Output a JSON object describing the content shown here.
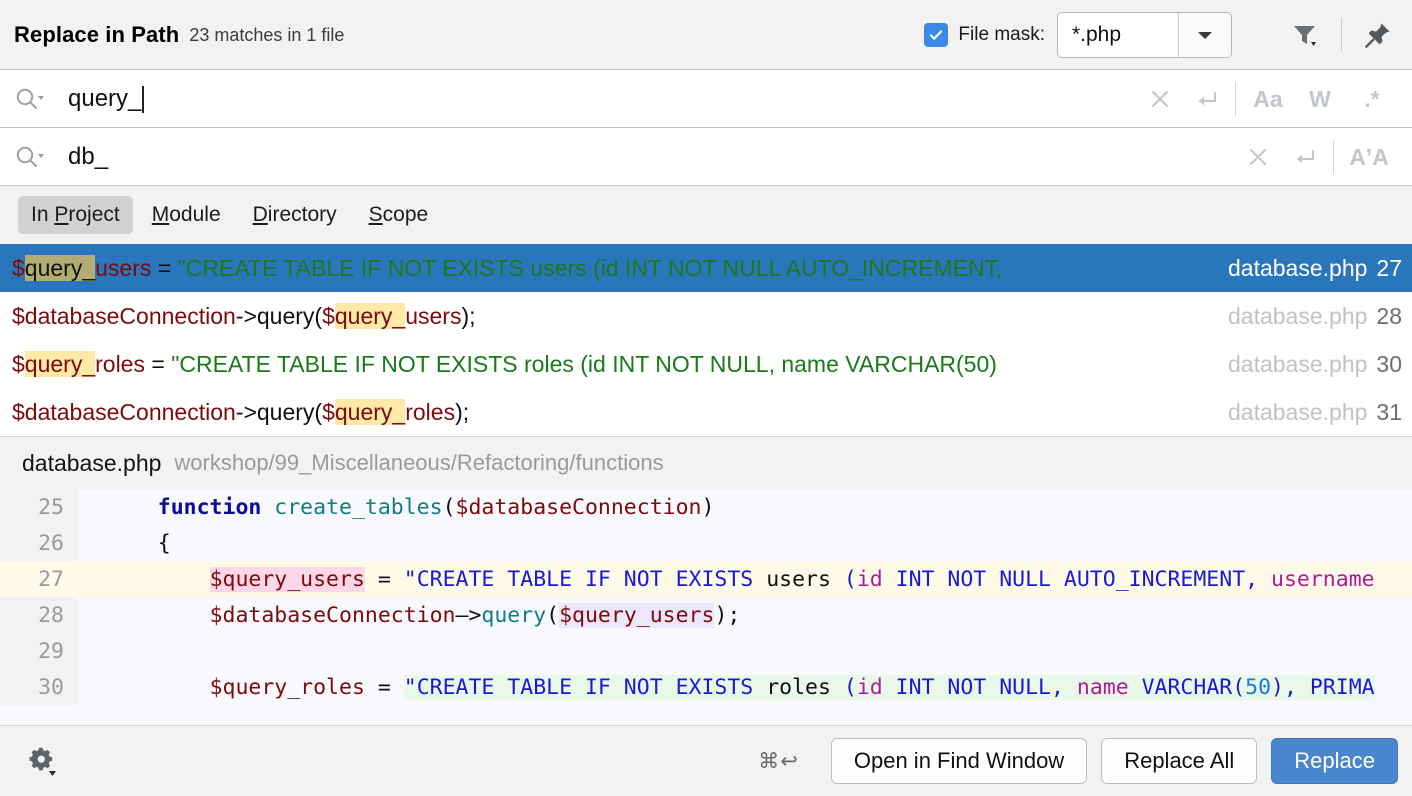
{
  "header": {
    "title": "Replace in Path",
    "subtitle": "23 matches in 1 file",
    "file_mask_label": "File mask:",
    "file_mask_value": "*.php",
    "file_mask_checked": true,
    "filter_icon": "filter-icon",
    "pin_icon": "pin-icon",
    "accent_color": "#4a86cd"
  },
  "search": {
    "value": "query_",
    "icon": "search-icon",
    "clear_icon": "close-icon",
    "history_icon": "new-line-icon",
    "options": [
      {
        "name": "match-case",
        "label": "Aa"
      },
      {
        "name": "words",
        "label": "W"
      },
      {
        "name": "regex",
        "label": ".*"
      }
    ]
  },
  "replace": {
    "value": "db_",
    "icon": "search-icon",
    "clear_icon": "close-icon",
    "history_icon": "new-line-icon",
    "options": [
      {
        "name": "preserve-case",
        "label": "AʼA"
      }
    ]
  },
  "scopes": {
    "items": [
      {
        "name": "in-project",
        "pre": "In ",
        "mnemonic": "P",
        "post": "roject",
        "active": true
      },
      {
        "name": "module",
        "pre": "",
        "mnemonic": "M",
        "post": "odule",
        "active": false
      },
      {
        "name": "directory",
        "pre": "",
        "mnemonic": "D",
        "post": "irectory",
        "active": false
      },
      {
        "name": "scope",
        "pre": "",
        "mnemonic": "S",
        "post": "cope",
        "active": false
      }
    ]
  },
  "results": {
    "rows": [
      {
        "selected": true,
        "file": "database.php",
        "line": "27",
        "segments": [
          {
            "cls": "v",
            "text": "$"
          },
          {
            "cls": "v hl",
            "text": "query_"
          },
          {
            "cls": "v",
            "text": "users"
          },
          {
            "cls": "p",
            "text": " = "
          },
          {
            "cls": "s",
            "text": "\"CREATE TABLE IF NOT EXISTS users (id INT NOT NULL AUTO_INCREMENT,"
          }
        ]
      },
      {
        "selected": false,
        "file": "database.php",
        "line": "28",
        "segments": [
          {
            "cls": "v",
            "text": "$databaseConnection"
          },
          {
            "cls": "p",
            "text": "->query("
          },
          {
            "cls": "v",
            "text": "$"
          },
          {
            "cls": "v hl",
            "text": "query_"
          },
          {
            "cls": "v",
            "text": "users"
          },
          {
            "cls": "p",
            "text": ");"
          }
        ]
      },
      {
        "selected": false,
        "file": "database.php",
        "line": "30",
        "segments": [
          {
            "cls": "v",
            "text": "$"
          },
          {
            "cls": "v hl",
            "text": "query_"
          },
          {
            "cls": "v",
            "text": "roles"
          },
          {
            "cls": "p",
            "text": " = "
          },
          {
            "cls": "s",
            "text": "\"CREATE TABLE IF NOT EXISTS roles (id INT NOT NULL, name VARCHAR(50)"
          }
        ]
      },
      {
        "selected": false,
        "file": "database.php",
        "line": "31",
        "segments": [
          {
            "cls": "v",
            "text": "$databaseConnection"
          },
          {
            "cls": "p",
            "text": "->query("
          },
          {
            "cls": "v",
            "text": "$"
          },
          {
            "cls": "v hl",
            "text": "query_"
          },
          {
            "cls": "v",
            "text": "roles"
          },
          {
            "cls": "p",
            "text": ");"
          }
        ]
      }
    ]
  },
  "preview": {
    "file": "database.php",
    "path": "workshop/99_Miscellaneous/Refactoring/functions",
    "lines": [
      {
        "num": "25",
        "highlight": false,
        "segments": [
          {
            "cls": "op",
            "text": "    "
          },
          {
            "cls": "kw",
            "text": "function"
          },
          {
            "cls": "op",
            "text": " "
          },
          {
            "cls": "fn2",
            "text": "create_tables"
          },
          {
            "cls": "op",
            "text": "("
          },
          {
            "cls": "var",
            "text": "$databaseConnection"
          },
          {
            "cls": "op",
            "text": ")"
          }
        ]
      },
      {
        "num": "26",
        "highlight": false,
        "segments": [
          {
            "cls": "op",
            "text": "    {"
          }
        ]
      },
      {
        "num": "27",
        "highlight": true,
        "segments": [
          {
            "cls": "op",
            "text": "        "
          },
          {
            "cls": "var mpink",
            "text": "$query_users"
          },
          {
            "cls": "op",
            "text": " = "
          },
          {
            "cls": "sqlkw",
            "text": "\"CREATE TABLE IF NOT EXISTS "
          },
          {
            "cls": "sqlplain",
            "text": "users "
          },
          {
            "cls": "sqlkw",
            "text": "("
          },
          {
            "cls": "sqlid",
            "text": "id"
          },
          {
            "cls": "sqlkw",
            "text": " INT NOT NULL AUTO_INCREMENT, "
          },
          {
            "cls": "sqlid",
            "text": "username"
          }
        ]
      },
      {
        "num": "28",
        "highlight": false,
        "segments": [
          {
            "cls": "op",
            "text": "        "
          },
          {
            "cls": "var",
            "text": "$databaseConnection"
          },
          {
            "cls": "op",
            "text": "–>"
          },
          {
            "cls": "fn2",
            "text": "query"
          },
          {
            "cls": "op",
            "text": "("
          },
          {
            "cls": "var mlav",
            "text": "$query_users"
          },
          {
            "cls": "op",
            "text": ");"
          }
        ]
      },
      {
        "num": "29",
        "highlight": false,
        "segments": [
          {
            "cls": "op",
            "text": ""
          }
        ]
      },
      {
        "num": "30",
        "highlight": false,
        "segments": [
          {
            "cls": "op",
            "text": "        "
          },
          {
            "cls": "var",
            "text": "$query_roles"
          },
          {
            "cls": "op",
            "text": " = "
          },
          {
            "cls": "sqlkw strg",
            "text": "\"CREATE TABLE IF NOT EXISTS "
          },
          {
            "cls": "sqlplain strg",
            "text": "roles "
          },
          {
            "cls": "sqlkw strg",
            "text": "("
          },
          {
            "cls": "sqlid strg",
            "text": "id"
          },
          {
            "cls": "sqlkw strg",
            "text": " INT NOT NULL, "
          },
          {
            "cls": "sqlid strg",
            "text": "name"
          },
          {
            "cls": "sqlkw strg",
            "text": " VARCHAR("
          },
          {
            "cls": "sqlnum strg",
            "text": "50"
          },
          {
            "cls": "sqlkw strg",
            "text": "), PRIMA"
          }
        ]
      }
    ]
  },
  "footer": {
    "settings_icon": "gear-icon",
    "shortcut": "⌘↩",
    "open_in_find_window": "Open in Find Window",
    "replace_all": "Replace All",
    "replace": "Replace"
  }
}
